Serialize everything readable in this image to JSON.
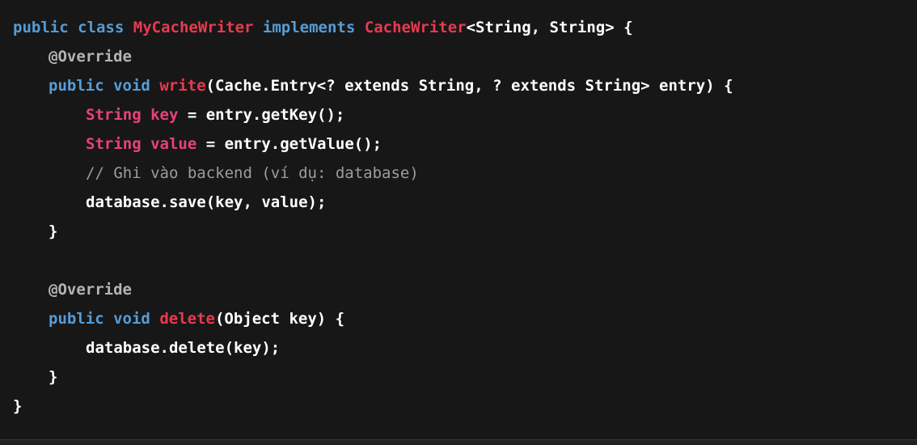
{
  "code": {
    "l1": {
      "kw_public": "public",
      "kw_class": "class",
      "class_name": "MyCacheWriter",
      "kw_implements": "implements",
      "iface": "CacheWriter",
      "rest": "<String, String> {"
    },
    "l2": {
      "annotation": "@Override"
    },
    "l3": {
      "kw_public": "public",
      "kw_void": "void",
      "method": "write",
      "rest": "(Cache.Entry<? extends String, ? extends String> entry) {"
    },
    "l4": {
      "type": "String",
      "var": "key",
      "rest": " = entry.getKey();"
    },
    "l5": {
      "type": "String",
      "var": "value",
      "rest": " = entry.getValue();"
    },
    "l6": {
      "comment": "// Ghi vào backend (ví dụ: database)"
    },
    "l7": {
      "text": "database.save(key, value);"
    },
    "l8": {
      "text": "}"
    },
    "l10": {
      "annotation": "@Override"
    },
    "l11": {
      "kw_public": "public",
      "kw_void": "void",
      "method": "delete",
      "rest": "(Object key) {"
    },
    "l12": {
      "text": "database.delete(key);"
    },
    "l13": {
      "text": "}"
    },
    "l14": {
      "text": "}"
    }
  },
  "colors": {
    "background": "#171717",
    "keyword": "#569cd6",
    "type_name": "#e83a4f",
    "variable": "#e8417d",
    "annotation": "#b4b4b4",
    "comment": "#9c9c9c",
    "plain": "#ffffff"
  }
}
